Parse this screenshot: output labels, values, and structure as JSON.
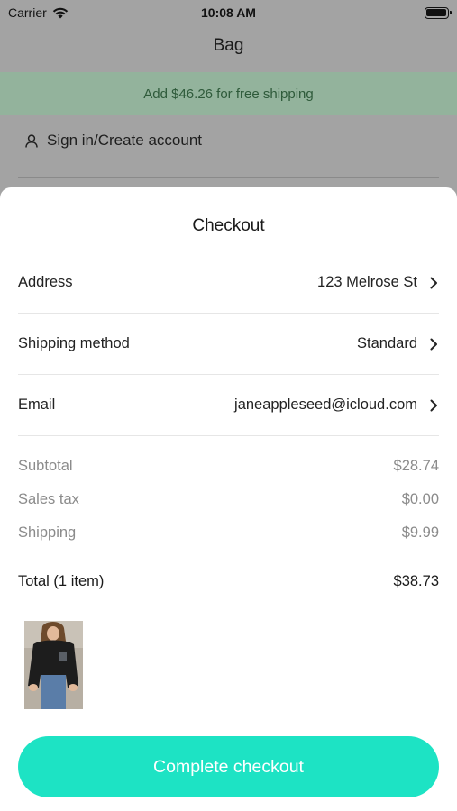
{
  "status_bar": {
    "carrier": "Carrier",
    "time": "10:08 AM"
  },
  "bag_page": {
    "title": "Bag",
    "shipping_banner": "Add $46.26 for free shipping",
    "signin_label": "Sign in/Create account"
  },
  "checkout": {
    "title": "Checkout",
    "rows": [
      {
        "label": "Address",
        "value": "123 Melrose St"
      },
      {
        "label": "Shipping method",
        "value": "Standard"
      },
      {
        "label": "Email",
        "value": "janeappleseed@icloud.com"
      }
    ],
    "summary": [
      {
        "label": "Subtotal",
        "value": "$28.74"
      },
      {
        "label": "Sales tax",
        "value": "$0.00"
      },
      {
        "label": "Shipping",
        "value": "$9.99"
      }
    ],
    "total": {
      "label": "Total (1 item)",
      "value": "$38.73"
    },
    "button_label": "Complete checkout"
  },
  "colors": {
    "accent": "#1de3c4",
    "banner": "#93b39c",
    "banner_text": "#2e5a3a"
  },
  "icons": [
    "wifi-icon",
    "battery-icon",
    "person-icon",
    "chevron-right-icon"
  ]
}
